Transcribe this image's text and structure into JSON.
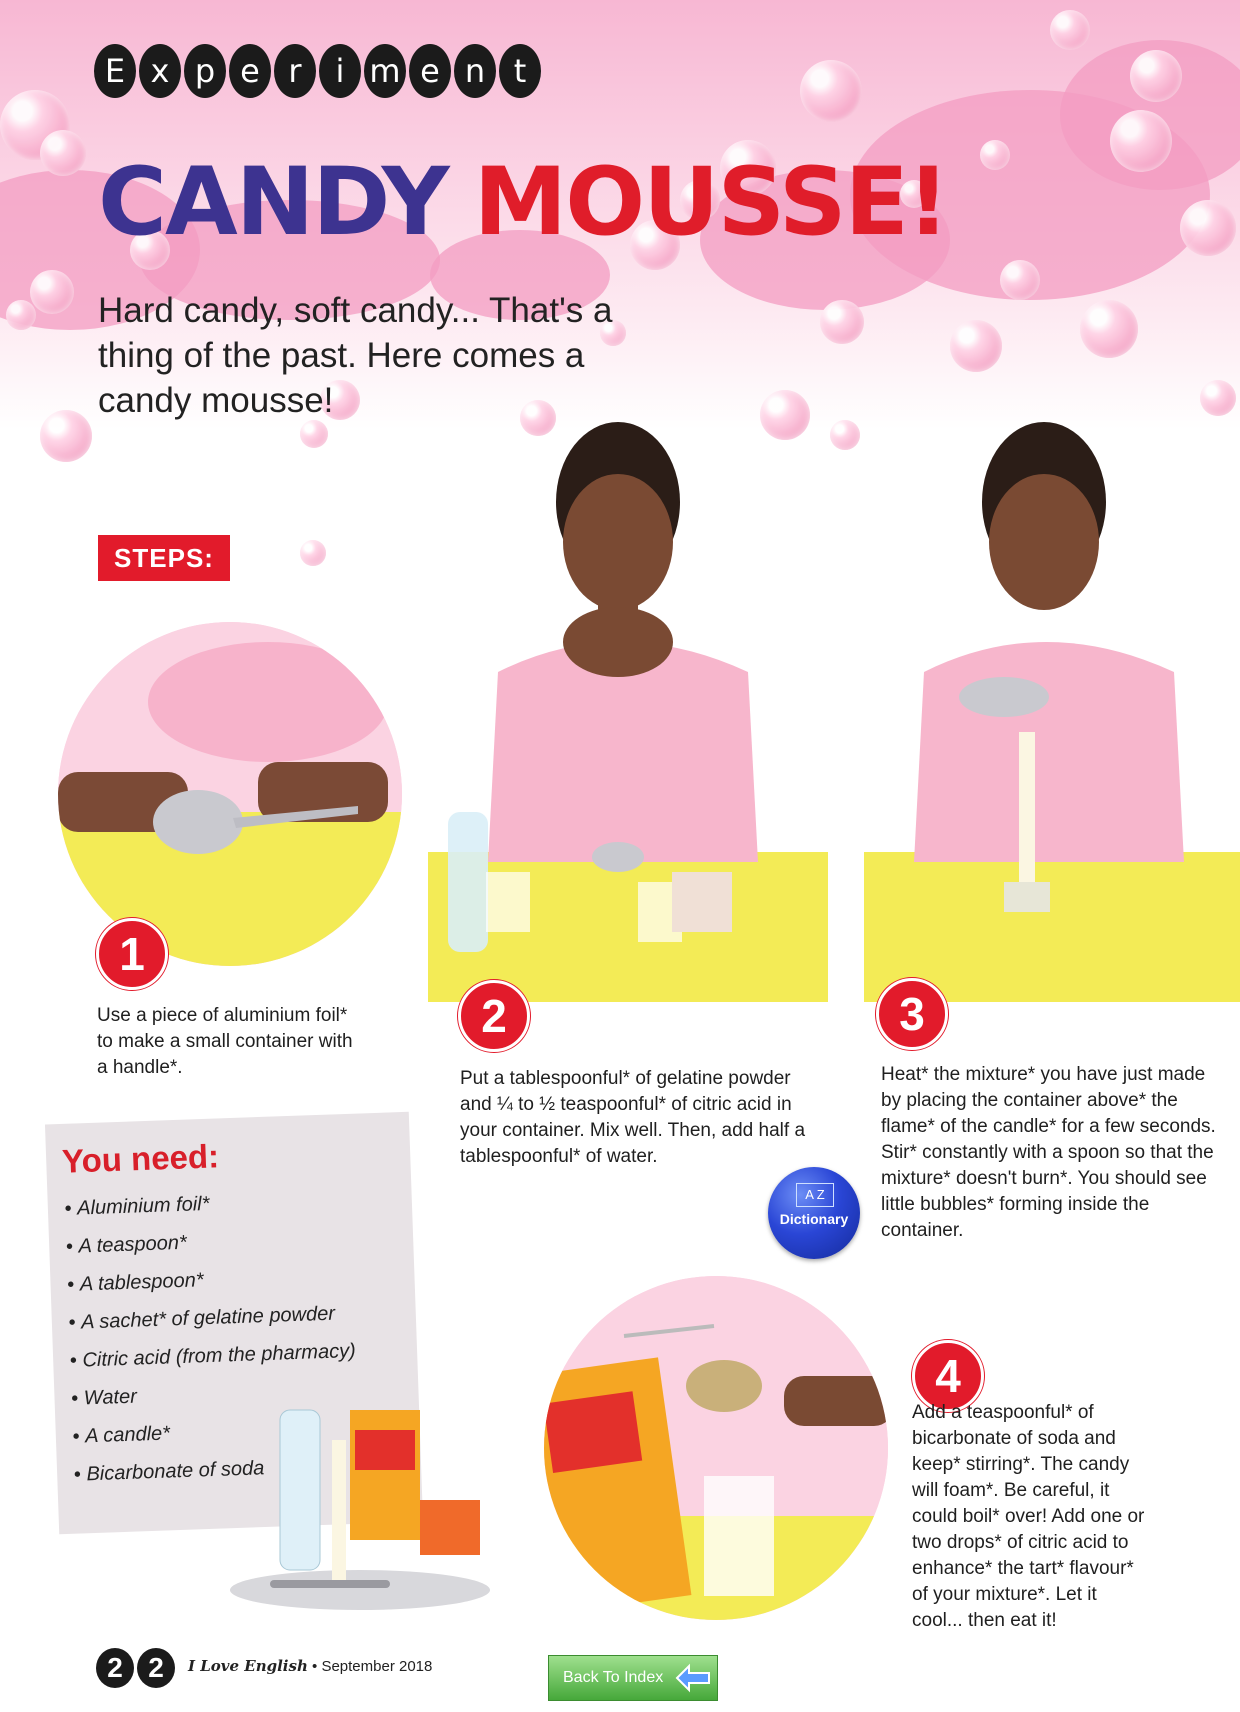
{
  "header": {
    "badge_letters": [
      "E",
      "x",
      "p",
      "e",
      "r",
      "i",
      "m",
      "e",
      "n",
      "t"
    ],
    "title_part1": "CANDY",
    "title_part2": "MOUSSE!",
    "intro": "Hard candy, soft candy... That's a thing of the past. Here comes a candy mousse!"
  },
  "steps_label": "STEPS:",
  "steps": [
    {
      "number": "1",
      "text": "Use a piece of aluminium foil* to make a small container with a handle*."
    },
    {
      "number": "2",
      "text": "Put a tablespoonful* of gelatine powder and ¼ to ½ teaspoonful* of citric acid in your container. Mix well. Then, add half a tablespoonful* of water."
    },
    {
      "number": "3",
      "text": "Heat* the mixture* you have just made by placing the container above* the flame* of the candle* for a few seconds. Stir* constantly with a spoon so that the mixture* doesn't burn*. You should see little bubbles* forming inside the container."
    },
    {
      "number": "4",
      "text": "Add a teaspoonful* of bicarbonate of soda and keep* stirring*. The candy will foam*. Be careful, it could boil* over! Add one or two drops* of citric acid to enhance* the tart* flavour* of your mixture*. Let it cool... then eat it!"
    }
  ],
  "you_need": {
    "title": "You need:",
    "items": [
      "Aluminium foil*",
      "A teaspoon*",
      "A tablespoon*",
      "A sachet* of gelatine powder",
      "Citric acid (from the pharmacy)",
      "Water",
      "A candle*",
      "Bicarbonate of soda"
    ]
  },
  "dictionary": {
    "az": "A Z",
    "label": "Dictionary"
  },
  "footer": {
    "page_digits": [
      "2",
      "2"
    ],
    "magazine": "I Love English",
    "issue": "• September 2018",
    "back_label": "Back To Index"
  },
  "colors": {
    "title_blue": "#3d3390",
    "title_red": "#e21b2b",
    "table_yellow": "#f3eb56",
    "pink": "#f39cc2"
  }
}
